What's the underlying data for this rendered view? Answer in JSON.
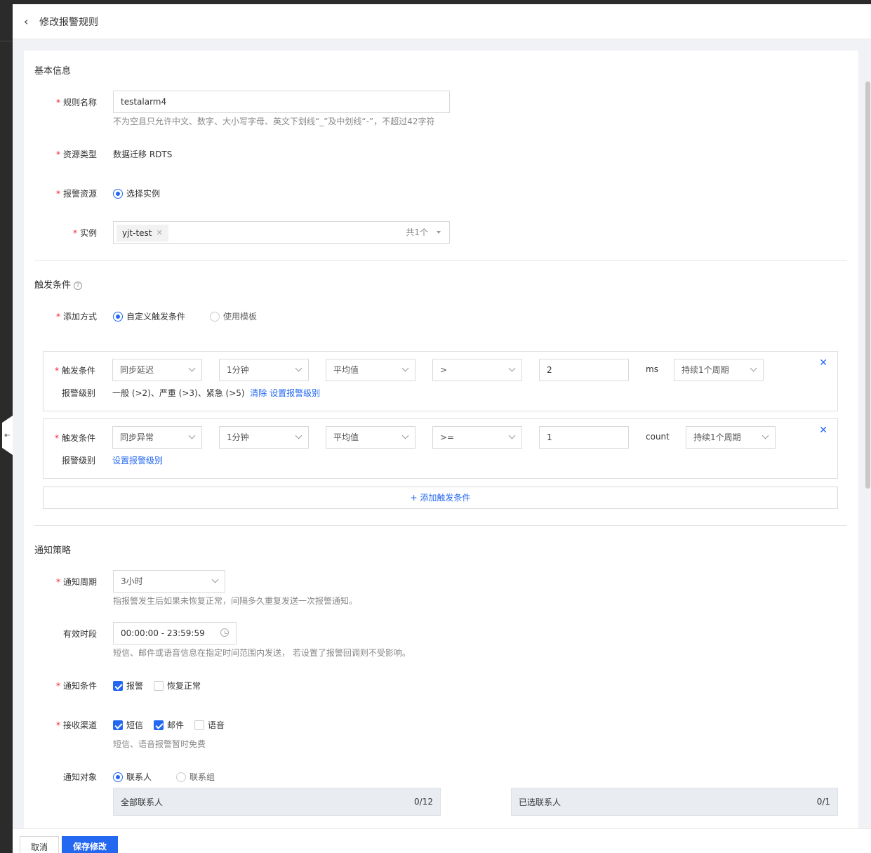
{
  "header": {
    "title": "修改报警规则"
  },
  "basic": {
    "section_title": "基本信息",
    "rule_name_label": "规则名称",
    "rule_name_value": "testalarm4",
    "rule_name_hint": "不为空且只允许中文、数字、大小写字母、英文下划线“_”及中划线“-”，不超过42字符",
    "resource_type_label": "资源类型",
    "resource_type_value": "数据迁移 RDTS",
    "alarm_resource_label": "报警资源",
    "alarm_resource_option": "选择实例",
    "instance_label": "实例",
    "instance_tag": "yjt-test",
    "instance_count": "共1个"
  },
  "trigger": {
    "section_title": "触发条件",
    "add_method_label": "添加方式",
    "add_method_options": [
      "自定义触发条件",
      "使用模板"
    ],
    "conditions": [
      {
        "label": "触发条件",
        "metric": "同步延迟",
        "period": "1分钟",
        "stat": "平均值",
        "operator": ">",
        "threshold": "2",
        "unit": "ms",
        "duration": "持续1个周期",
        "level_label": "报警级别",
        "level_text": "一般 (>2)、严重 (>3)、紧急 (>5)",
        "clear_link": "清除",
        "set_level_link": "设置报警级别"
      },
      {
        "label": "触发条件",
        "metric": "同步异常",
        "period": "1分钟",
        "stat": "平均值",
        "operator": ">=",
        "threshold": "1",
        "unit": "count",
        "duration": "持续1个周期",
        "level_label": "报警级别",
        "level_text": "",
        "clear_link": "",
        "set_level_link": "设置报警级别"
      }
    ],
    "add_button": "+ 添加触发条件"
  },
  "notify": {
    "section_title": "通知策略",
    "cycle_label": "通知周期",
    "cycle_value": "3小时",
    "cycle_hint": "指报警发生后如果未恢复正常，间隔多久重复发送一次报警通知。",
    "period_label": "有效时段",
    "period_value": "00:00:00 - 23:59:59",
    "period_hint": "短信、邮件或语音信息在指定时间范围内发送， 若设置了报警回调则不受影响。",
    "condition_label": "通知条件",
    "condition_options": [
      {
        "label": "报警",
        "checked": true
      },
      {
        "label": "恢复正常",
        "checked": false
      }
    ],
    "channel_label": "接收渠道",
    "channel_options": [
      {
        "label": "短信",
        "checked": true
      },
      {
        "label": "邮件",
        "checked": true
      },
      {
        "label": "语音",
        "checked": false
      }
    ],
    "channel_hint": "短信、语音报警暂时免费",
    "target_label": "通知对象",
    "target_options": [
      "联系人",
      "联系组"
    ],
    "all_contacts_title": "全部联系人",
    "all_contacts_count": "0/12",
    "selected_contacts_title": "已选联系人",
    "selected_contacts_count": "0/1"
  },
  "footer": {
    "cancel": "取消",
    "save": "保存修改"
  },
  "colors": {
    "primary": "#2468f2",
    "required": "#f5222d"
  }
}
